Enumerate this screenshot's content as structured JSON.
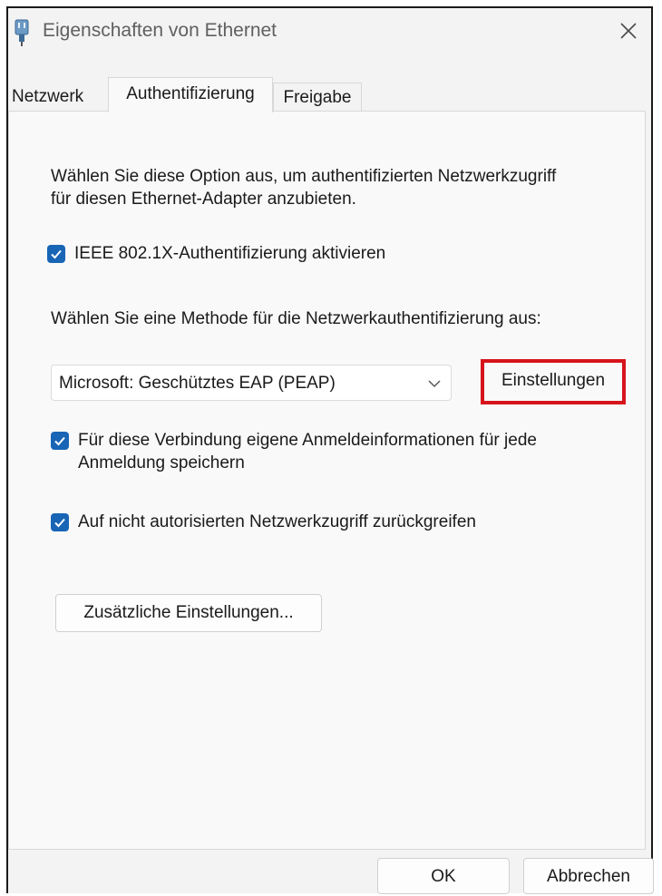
{
  "window": {
    "title": "Eigenschaften von Ethernet",
    "icon": "network-adapter-icon",
    "close_icon": "close-icon"
  },
  "tabs": [
    {
      "label": "Netzwerk",
      "active": false
    },
    {
      "label": "Authentifizierung",
      "active": true
    },
    {
      "label": "Freigabe",
      "active": false
    }
  ],
  "auth": {
    "intro": "Wählen Sie diese Option aus, um authentifizierten Netzwerkzugriff für diesen Ethernet-Adapter anzubieten.",
    "enable_8021x": {
      "label": "IEEE 802.1X-Authentifizierung aktivieren",
      "checked": true
    },
    "method_label": "Wählen Sie eine Methode für die Netzwerkauthentifizierung aus:",
    "method_select": {
      "value": "Microsoft: Geschütztes EAP (PEAP)",
      "icon": "chevron-down-icon"
    },
    "settings_button": "Einstellungen",
    "remember_credentials": {
      "label": "Für diese Verbindung eigene Anmeldeinformationen für jede Anmeldung speichern",
      "checked": true
    },
    "fallback_unauthorized": {
      "label": "Auf nicht autorisierten Netzwerkzugriff zurückgreifen",
      "checked": true
    },
    "additional_settings_button": "Zusätzliche Einstellungen..."
  },
  "footer": {
    "ok_button": "OK",
    "cancel_button": "Abbrechen"
  },
  "colors": {
    "accent": "#1865b6",
    "highlight": "#d6141c",
    "window_bg": "#f3f3f3",
    "panel_bg": "#f9f9f9"
  }
}
